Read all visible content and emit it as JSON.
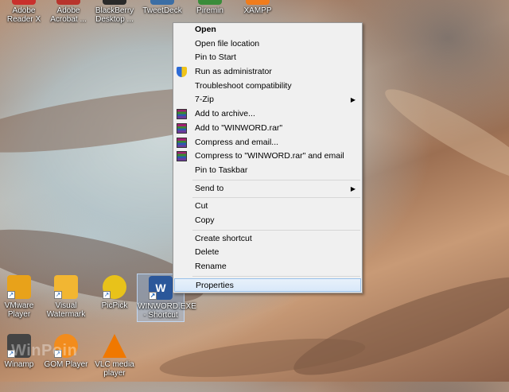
{
  "desktop_top_row": [
    {
      "label": "Adobe Reader X",
      "icon": "adobe-reader-icon",
      "color": "#c9302c"
    },
    {
      "label": "Adobe Acrobat ...",
      "icon": "adobe-acrobat-icon",
      "color": "#b8342c"
    },
    {
      "label": "BlackBerry Desktop ...",
      "icon": "blackberry-icon",
      "color": "#2a2a2a"
    },
    {
      "label": "TweetDeck",
      "icon": "tweetdeck-icon",
      "color": "#3b6ea5"
    },
    {
      "label": "Piremin",
      "icon": "piremin-icon",
      "color": "#3a8c3a"
    },
    {
      "label": "XAMPP",
      "icon": "xampp-icon",
      "color": "#f07c1c"
    }
  ],
  "desktop_bottom": [
    {
      "label": "VMware Player",
      "icon": "vmware-icon",
      "color": "#e8a21a"
    },
    {
      "label": "Visual Watermark",
      "icon": "visual-watermark-icon",
      "color": "#f2b632"
    },
    {
      "label": "PicPick",
      "icon": "picpick-icon",
      "color": "#e8c21a"
    },
    {
      "label": "WINWORD.EXE - Shortcut",
      "icon": "word-icon",
      "color": "#2b579a"
    },
    {
      "label": "Winamp",
      "icon": "winamp-icon",
      "color": "#444444"
    },
    {
      "label": "GOM Player",
      "icon": "gom-player-icon",
      "color": "#f28c1c"
    },
    {
      "label": "VLC media player",
      "icon": "vlc-icon",
      "color": "#f07800"
    }
  ],
  "context_menu": {
    "items": [
      {
        "label": "Open",
        "bold": true
      },
      {
        "label": "Open file location"
      },
      {
        "label": "Pin to Start"
      },
      {
        "label": "Run as administrator",
        "icon": "uac-shield-icon"
      },
      {
        "label": "Troubleshoot compatibility"
      },
      {
        "label": "7-Zip",
        "submenu": true
      },
      {
        "label": "Add to archive...",
        "icon": "winrar-icon"
      },
      {
        "label": "Add to \"WINWORD.rar\"",
        "icon": "winrar-icon"
      },
      {
        "label": "Compress and email...",
        "icon": "winrar-icon"
      },
      {
        "label": "Compress to \"WINWORD.rar\" and email",
        "icon": "winrar-icon"
      },
      {
        "label": "Pin to Taskbar"
      },
      {
        "label": "Send to",
        "submenu": true
      },
      {
        "label": "Cut"
      },
      {
        "label": "Copy"
      },
      {
        "label": "Create shortcut"
      },
      {
        "label": "Delete"
      },
      {
        "label": "Rename"
      },
      {
        "label": "Properties",
        "highlighted": true
      }
    ],
    "submenu_glyph": "▶"
  },
  "watermark": "WinPoin"
}
